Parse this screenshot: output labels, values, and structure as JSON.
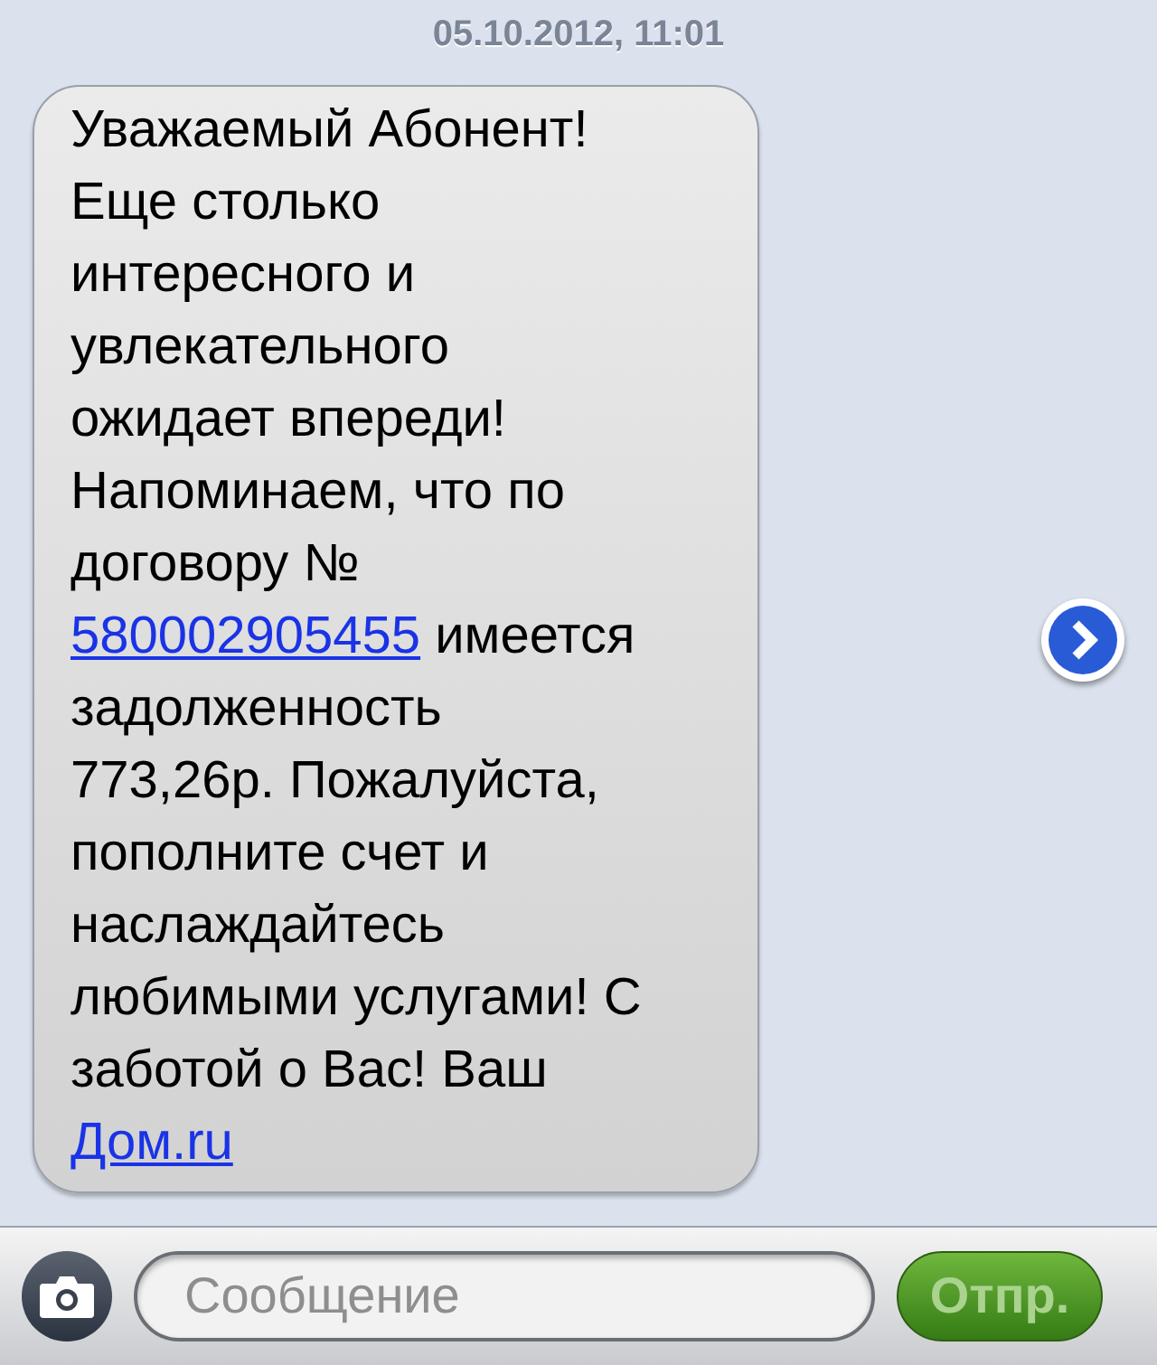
{
  "timestamp": "05.10.2012, 11:01",
  "message": {
    "lines": [
      [
        {
          "kind": "text",
          "text": "Уважаемый Абонент!"
        }
      ],
      [
        {
          "kind": "text",
          "text": "Еще столько"
        }
      ],
      [
        {
          "kind": "text",
          "text": "интересного и"
        }
      ],
      [
        {
          "kind": "text",
          "text": "увлекательного"
        }
      ],
      [
        {
          "kind": "text",
          "text": "ожидает впереди!"
        }
      ],
      [
        {
          "kind": "text",
          "text": "Напоминаем, что по"
        }
      ],
      [
        {
          "kind": "text",
          "text": "договору №"
        }
      ],
      [
        {
          "kind": "link",
          "text": "580002905455"
        },
        {
          "kind": "text",
          "text": " имеется"
        }
      ],
      [
        {
          "kind": "text",
          "text": "задолженность"
        }
      ],
      [
        {
          "kind": "text",
          "text": "773,26р. Пожалуйста,"
        }
      ],
      [
        {
          "kind": "text",
          "text": "пополните счет и"
        }
      ],
      [
        {
          "kind": "text",
          "text": "наслаждайтесь"
        }
      ],
      [
        {
          "kind": "text",
          "text": "любимыми услугами! С"
        }
      ],
      [
        {
          "kind": "text",
          "text": "заботой о Вас! Ваш"
        }
      ],
      [
        {
          "kind": "link",
          "text": "Дом.ru"
        }
      ]
    ]
  },
  "composer": {
    "placeholder": "Сообщение",
    "send_button": "Отпр."
  }
}
